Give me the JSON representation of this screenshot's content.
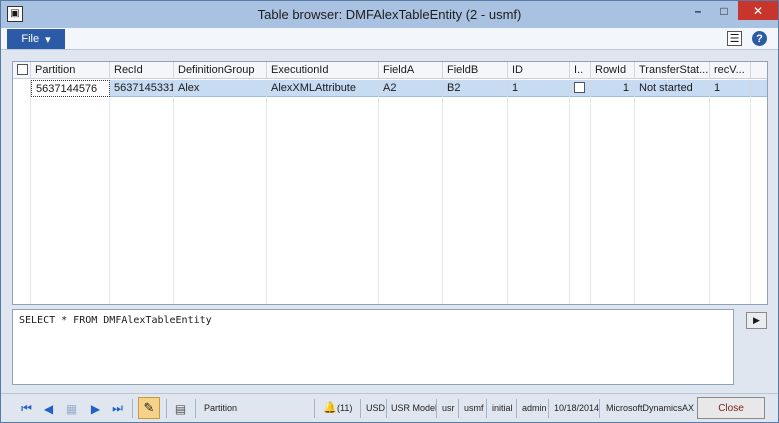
{
  "window": {
    "title": "Table browser: DMFAlexTableEntity (2 - usmf)",
    "app_icon": "dynamics-ax-icon",
    "app_icon_glyph": "▣"
  },
  "window_controls": {
    "minimize": "–",
    "maximize": "□",
    "close": "✕"
  },
  "ribbon": {
    "file_label": "File",
    "file_caret": "▾",
    "layout_icon": "☰",
    "help_icon": "?"
  },
  "grid": {
    "columns": [
      "Partition",
      "RecId",
      "DefinitionGroup",
      "ExecutionId",
      "FieldA",
      "FieldB",
      "ID",
      "I..",
      "RowId",
      "TransferStat...",
      "recV..."
    ],
    "rows": [
      {
        "Partition": "5637144576",
        "RecId": "5637145331",
        "DefinitionGroup": "Alex",
        "ExecutionId": "AlexXMLAttribute",
        "FieldA": "A2",
        "FieldB": "B2",
        "ID": "1",
        "I": "",
        "RowId": "1",
        "TransferStatus": "Not started",
        "recVersion": "1"
      }
    ]
  },
  "sql": {
    "query": "SELECT * FROM DMFAlexTableEntity",
    "execute_glyph": "▶"
  },
  "statusbar": {
    "nav_first": "⏮",
    "nav_prev": "◀",
    "nav_grid": "▦",
    "nav_next": "▶",
    "nav_last": "⏭",
    "edit_glyph": "✎",
    "doc_glyph": "▤",
    "field_name": "Partition",
    "bell_glyph": "🔔",
    "notifications": "(11)",
    "currency": "USD",
    "model": "USR Model",
    "layer": "usr",
    "company": "usmf",
    "partition": "initial",
    "user": "admin",
    "date": "10/18/2014",
    "server": "MicrosoftDynamicsAX",
    "close_label": "Close"
  }
}
